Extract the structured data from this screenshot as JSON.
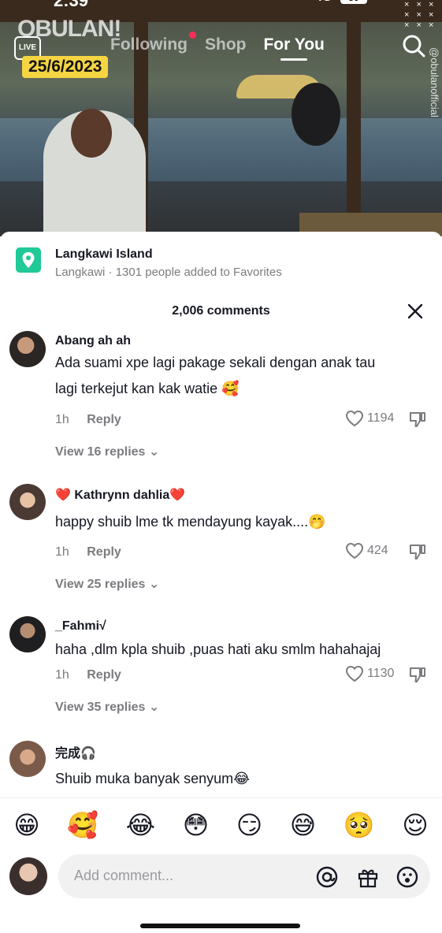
{
  "status": {
    "time": "2:39",
    "signal": "4G",
    "battery": "86"
  },
  "video": {
    "watermark_logo": "OBULAN!",
    "date_badge": "25/6/2023",
    "side_watermark": "@obulanofficial",
    "tabs": [
      {
        "label": "Following",
        "active": false
      },
      {
        "label": "Shop",
        "active": false
      },
      {
        "label": "For You",
        "active": true
      }
    ],
    "live_label": "LIVE"
  },
  "location": {
    "title": "Langkawi Island",
    "subtitle": "Langkawi · 1301 people added to Favorites"
  },
  "comments_header": {
    "count_label": "2,006 comments"
  },
  "comments": [
    {
      "username": "Abang ah ah",
      "text_lines": [
        "Ada suami xpe lagi pakage sekali dengan anak tau",
        "lagi terkejut kan kak watie 🥰"
      ],
      "time": "1h",
      "reply_label": "Reply",
      "likes": "1194",
      "view_replies": "View 16 replies ⌄"
    },
    {
      "username": "❤️ Kathrynn dahlia❤️",
      "text_lines": [
        "happy shuib lme tk mendayung kayak....🤭"
      ],
      "time": "1h",
      "reply_label": "Reply",
      "likes": "424",
      "view_replies": "View 25 replies ⌄"
    },
    {
      "username": "_Fahmi√",
      "text_lines": [
        "haha ,dlm kpla shuib ,puas hati aku smlm hahahajaj"
      ],
      "time": "1h",
      "reply_label": "Reply",
      "likes": "1130",
      "view_replies": "View 35 replies ⌄"
    },
    {
      "username": "完成🎧",
      "text_lines": [
        "Shuib muka banyak senyum😂"
      ]
    }
  ],
  "emoji_bar": [
    "😁",
    "🥰",
    "😂",
    "😳",
    "😏",
    "😅",
    "🥺",
    "😌"
  ],
  "composer": {
    "placeholder": "Add comment..."
  },
  "colors": {
    "accent": "#fe2c55",
    "location_icon": "#20c997",
    "date_badge": "#f6d543"
  }
}
